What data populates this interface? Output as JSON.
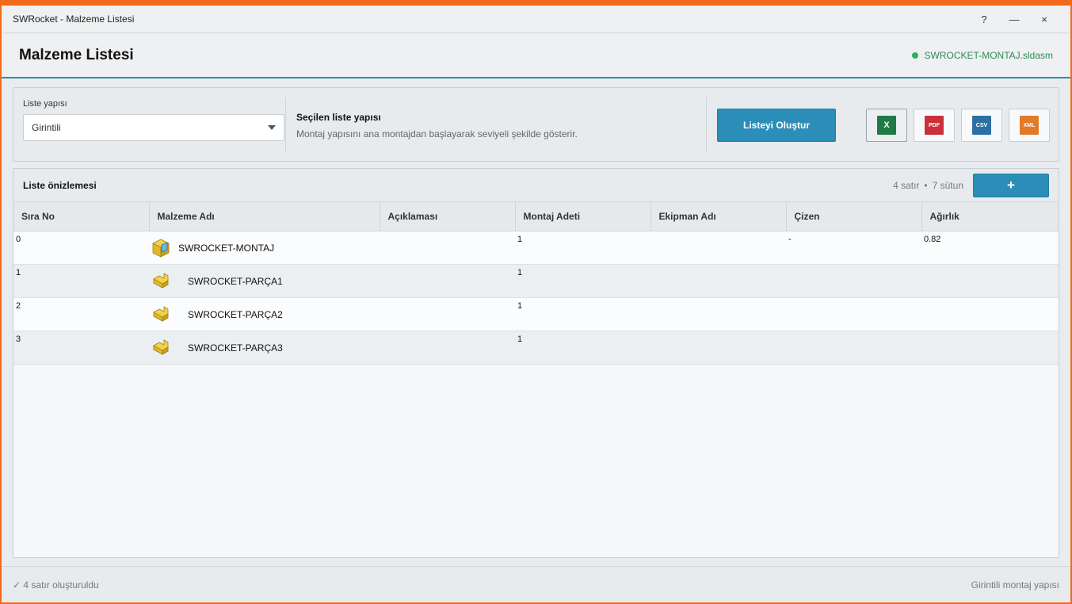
{
  "window": {
    "title": "SWRocket - Malzeme Listesi",
    "help_label": "?",
    "minimize_label": "—",
    "close_label": "×"
  },
  "header": {
    "title": "Malzeme Listesi",
    "file_name": "SWROCKET-MONTAJ.sldasm",
    "status_color": "#2fb05a"
  },
  "config": {
    "structure_label": "Liste yapısı",
    "structure_value": "Girintili",
    "selected_title": "Seçilen liste yapısı",
    "selected_desc": "Montaj yapısını ana montajdan başlayarak seviyeli şekilde gösterir.",
    "create_button": "Listeyi Oluştur",
    "exports": [
      {
        "label": "X",
        "color": "#1f7a44",
        "icon": "excel-icon"
      },
      {
        "label": "PDF",
        "color": "#c9303a",
        "icon": "pdf-icon"
      },
      {
        "label": "CSV",
        "color": "#2d6fa3",
        "icon": "csv-icon"
      },
      {
        "label": "XML",
        "color": "#e07b2a",
        "icon": "xml-icon"
      }
    ]
  },
  "preview": {
    "title": "Liste önizlemesi",
    "row_count": "4 satır",
    "separator": "•",
    "col_count": "7 sütun",
    "add_label": "+",
    "columns": [
      "Sıra No",
      "Malzeme Adı",
      "Açıklaması",
      "Montaj Adeti",
      "Ekipman Adı",
      "Çizen",
      "Ağırlık"
    ],
    "rows": [
      {
        "no": "0",
        "name": "SWROCKET-MONTAJ",
        "desc": "",
        "qty": "1",
        "equip": "",
        "drawn": "-",
        "weight": "0.82",
        "icon": "assembly-icon"
      },
      {
        "no": "1",
        "name": "SWROCKET-PARÇA1",
        "desc": "",
        "qty": "1",
        "equip": "",
        "drawn": "",
        "weight": "",
        "icon": "part-icon"
      },
      {
        "no": "2",
        "name": "SWROCKET-PARÇA2",
        "desc": "",
        "qty": "1",
        "equip": "",
        "drawn": "",
        "weight": "",
        "icon": "part-icon"
      },
      {
        "no": "3",
        "name": "SWROCKET-PARÇA3",
        "desc": "",
        "qty": "1",
        "equip": "",
        "drawn": "",
        "weight": "",
        "icon": "part-icon"
      }
    ]
  },
  "statusbar": {
    "left": "✓ 4 satır oluşturuldu",
    "right": "Girintili montaj yapısı"
  }
}
